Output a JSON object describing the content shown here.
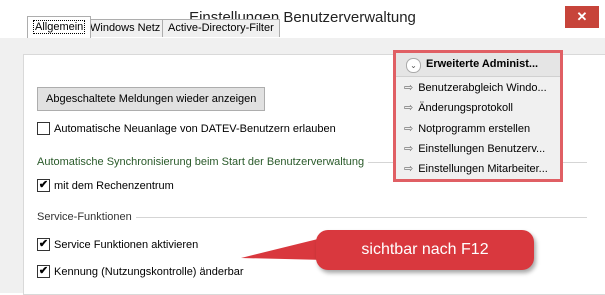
{
  "window": {
    "title": "Einstellungen Benutzerverwaltung",
    "close_icon": "close-icon"
  },
  "tabs": [
    {
      "label": "Allgemein",
      "active": true
    },
    {
      "label": "Windows Netz",
      "active": false
    },
    {
      "label": "Active-Directory-Filter",
      "active": false
    }
  ],
  "general": {
    "show_messages_button": "Abgeschaltete Meldungen wieder anzeigen",
    "auto_create": {
      "label": "Automatische Neuanlage von DATEV-Benutzern erlauben",
      "checked": false
    },
    "sync_group": {
      "title": "Automatische Synchronisierung beim Start der Benutzerverwaltung",
      "with_datacenter": {
        "label": "mit dem Rechenzentrum",
        "checked": true
      }
    },
    "service_group": {
      "title": "Service-Funktionen",
      "activate": {
        "label": "Service Funktionen aktivieren",
        "checked": true
      },
      "id_changeable": {
        "label": "Kennung (Nutzungskontrolle) änderbar",
        "checked": true
      }
    }
  },
  "advanced_menu": {
    "title": "Erweiterte Administ...",
    "chevron_icon": "chevron-down-icon",
    "item_icon": "arrow-right-icon",
    "items": [
      "Benutzerabgleich Windo...",
      "Änderungsprotokoll",
      "Notprogramm erstellen",
      "Einstellungen Benutzerv...",
      "Einstellungen Mitarbeiter..."
    ]
  },
  "annotation": {
    "text": "sichtbar nach F12",
    "color": "#d9383e"
  },
  "glyphs": {
    "check": "✔",
    "arrow": "⇨",
    "chevron": "⌄",
    "close": "✕"
  }
}
